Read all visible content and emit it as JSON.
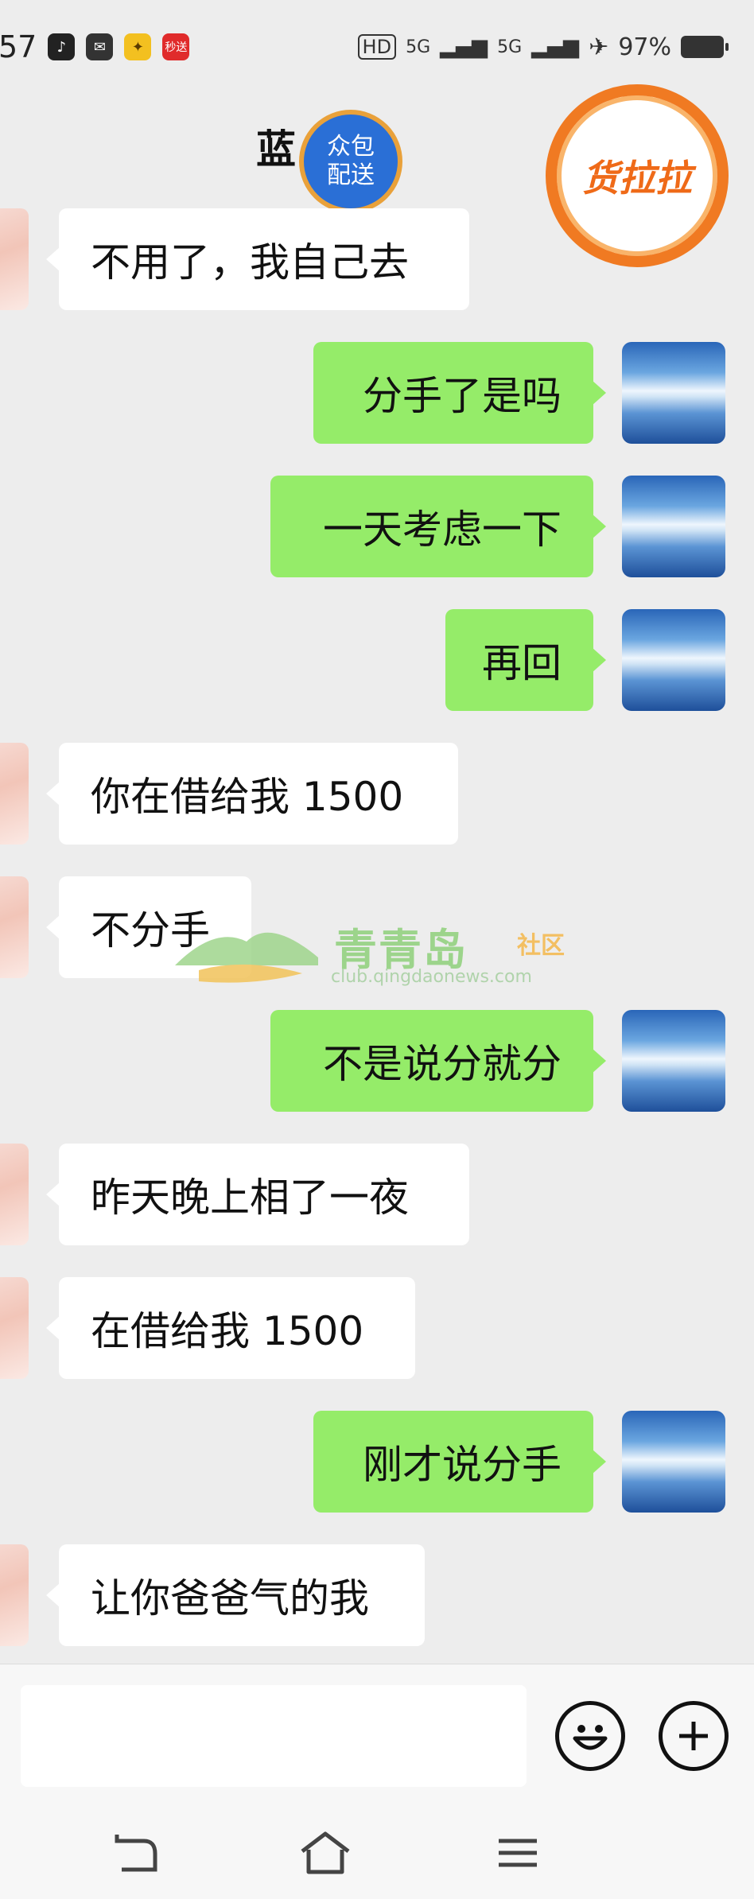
{
  "status_bar": {
    "time": "57",
    "network_1": "HD",
    "network_2": "5G",
    "network_3": "5G",
    "battery": "97%",
    "app_icons": [
      "tiktok-icon",
      "mail-icon",
      "game-icon",
      "flash-sale-icon"
    ],
    "flash_sale_label": "秒送"
  },
  "header": {
    "title": "蓝",
    "badge_left": [
      "众包",
      "配送"
    ],
    "badge_right": "货拉拉"
  },
  "messages": [
    {
      "side": "in",
      "text": "不用了，我自己去"
    },
    {
      "side": "out",
      "text": "分手了是吗"
    },
    {
      "side": "out",
      "text": "一天考虑一下"
    },
    {
      "side": "out",
      "text": "再回"
    },
    {
      "side": "in",
      "text": "你在借给我 1500"
    },
    {
      "side": "in",
      "text": "不分手"
    },
    {
      "side": "out",
      "text": "不是说分就分"
    },
    {
      "side": "in",
      "text": "昨天晚上相了一夜"
    },
    {
      "side": "in",
      "text": "在借给我 1500"
    },
    {
      "side": "out",
      "text": "刚才说分手"
    },
    {
      "side": "in",
      "text": "让你爸爸气的我"
    }
  ],
  "watermark": {
    "name": "青青岛",
    "sub": "社区",
    "url": "club.qingdaonews.com"
  },
  "input": {
    "placeholder": ""
  },
  "colors": {
    "outgoing_bubble": "#95ec69",
    "incoming_bubble": "#ffffff",
    "background": "#ededed"
  }
}
